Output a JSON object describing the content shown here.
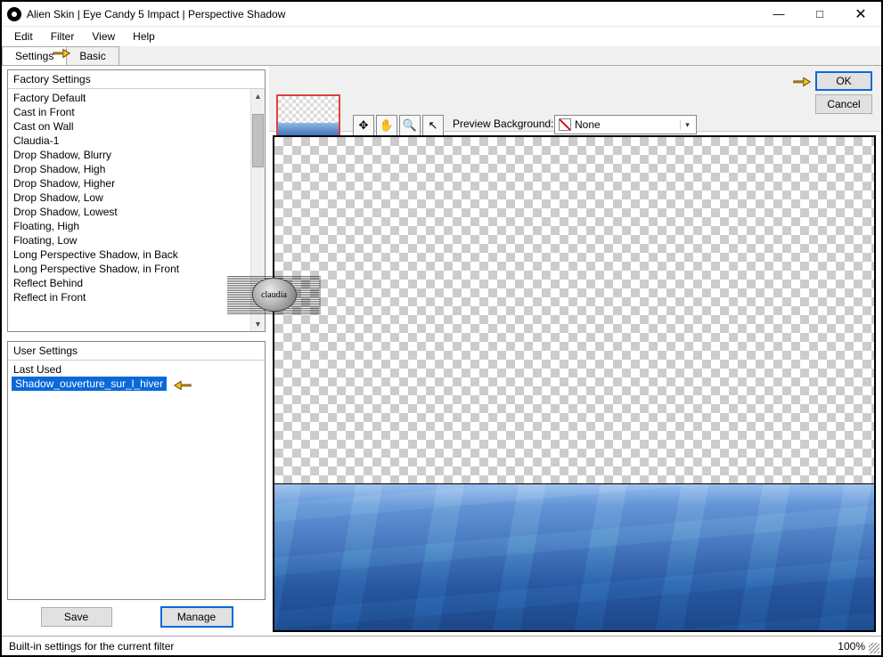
{
  "window": {
    "title": "Alien Skin | Eye Candy 5 Impact | Perspective Shadow"
  },
  "menu": {
    "edit": "Edit",
    "filter": "Filter",
    "view": "View",
    "help": "Help"
  },
  "tabs": {
    "settings": "Settings",
    "basic": "Basic"
  },
  "actions": {
    "ok": "OK",
    "cancel": "Cancel",
    "save": "Save",
    "manage": "Manage"
  },
  "factory": {
    "header": "Factory Settings",
    "items": [
      "Factory Default",
      "Cast in Front",
      "Cast on Wall",
      "Claudia-1",
      "Drop Shadow, Blurry",
      "Drop Shadow, High",
      "Drop Shadow, Higher",
      "Drop Shadow, Low",
      "Drop Shadow, Lowest",
      "Floating, High",
      "Floating, Low",
      "Long Perspective Shadow, in Back",
      "Long Perspective Shadow, in Front",
      "Reflect Behind",
      "Reflect in Front"
    ]
  },
  "user": {
    "header": "User Settings",
    "items": [
      "Last Used",
      "Shadow_ouverture_sur_l_hiver"
    ],
    "selected_index": 1
  },
  "preview": {
    "bg_label": "Preview Background:",
    "bg_value": "None"
  },
  "status": {
    "text": "Built-in settings for the current filter",
    "zoom": "100%"
  },
  "watermark": {
    "text": "claudia"
  },
  "tools": {
    "t0": "move-tool-icon",
    "t1": "hand-tool-icon",
    "t2": "zoom-tool-icon",
    "t3": "pointer-tool-icon"
  }
}
